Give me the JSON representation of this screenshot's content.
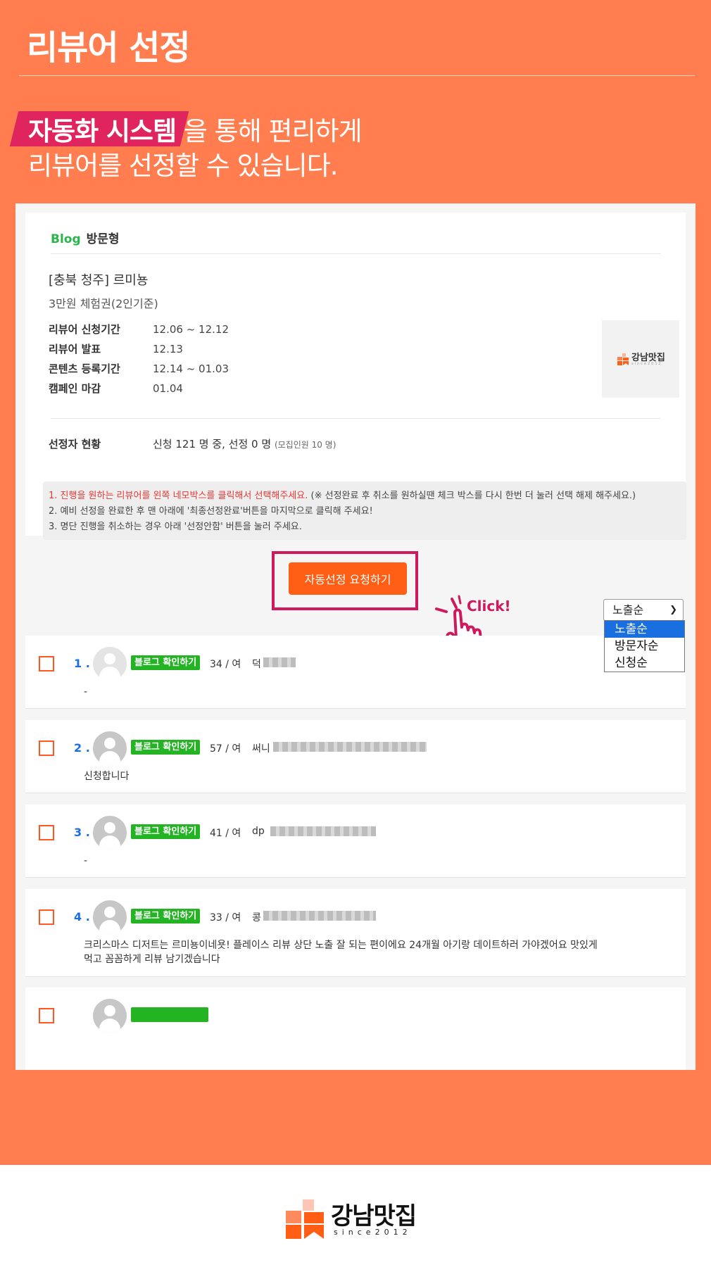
{
  "header": {
    "title": "리뷰어 선정",
    "highlight": "자동화 시스템",
    "line1_rest": " 을 통해 편리하게",
    "line2": "리뷰어를 선정할 수 있습니다."
  },
  "campaign": {
    "platform": "Blog",
    "type": "방문형",
    "title": "[충북 청주] 르미뇽",
    "subtitle": "3만원 체험권(2인기준)",
    "schedule": [
      {
        "label": "리뷰어 신청기간",
        "value": "12.06 ~ 12.12"
      },
      {
        "label": "리뷰어 발표",
        "value": "12.13"
      },
      {
        "label": "콘텐츠 등록기간",
        "value": "12.14 ~ 01.03"
      },
      {
        "label": "캠페인 마감",
        "value": "01.04"
      }
    ],
    "status_label": "선정자 현황",
    "status_value": "신청 121 명 중, 선정 0 명",
    "status_note": "(모집인원 10 명)",
    "logo_text": "강남맛집",
    "logo_sub": "since2012"
  },
  "notice": {
    "line1_red": "1. 진행을 원하는 리뷰어를 왼쪽 네모박스를 클릭해서 선택해주세요.",
    "line1_rest": " (※ 선정완료 후 취소를 원하실땐 체크 박스를 다시 한번 더 눌러 선택 해제 해주세요.)",
    "line2": "2. 예비 선정을 완료한 후 맨 아래에 '최종선정완료'버튼을 마지막으로 클릭해 주세요!",
    "line3": "3. 명단 진행을 취소하는 경우 아래 '선정안함' 버튼을 눌러 주세요."
  },
  "auto_button": "자동선정 요청하기",
  "click_label": "Click!",
  "sort": {
    "selected": "노출순",
    "options": [
      "노출순",
      "방문자순",
      "신청순"
    ]
  },
  "blog_button": "블로그 확인하기",
  "applicants": [
    {
      "num": "1 .",
      "age": "34 / 여",
      "nick": "덕",
      "comment": "-"
    },
    {
      "num": "2 .",
      "age": "57 / 여",
      "nick": "써니",
      "comment": "신청합니다"
    },
    {
      "num": "3 .",
      "age": "41 / 여",
      "nick": "dp",
      "comment": "-"
    },
    {
      "num": "4 .",
      "age": "33 / 여",
      "nick": "콩",
      "comment": "크리스마스 디저트는 르미뇽이네욧! 플레이스 리뷰 상단 노출 잘 되는 편이에요 24개월 아기랑 데이트하러 가야겠어요 맛있게 먹고 꼼꼼하게 리뷰 남기겠습니다"
    }
  ],
  "footer": {
    "brand": "강남맛집",
    "since": "since2012"
  },
  "colors": {
    "background": "#ff7d4e",
    "accent": "#ff5e14",
    "highlight": "#e0245e",
    "blog_green": "#23b323",
    "number_blue": "#1a6fe0"
  }
}
